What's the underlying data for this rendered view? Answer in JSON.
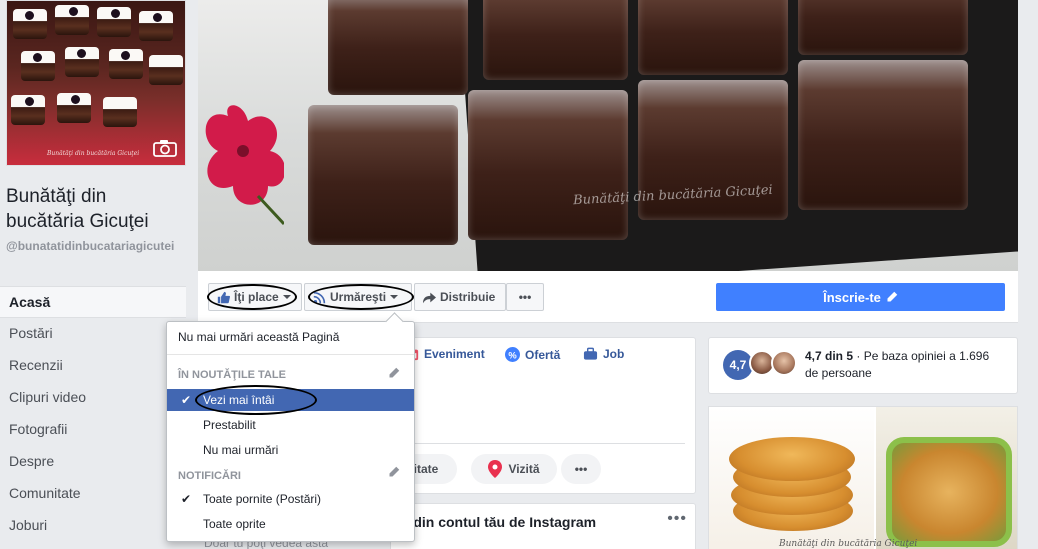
{
  "page": {
    "name": "Bunătăţi din bucătăria Gicuţei",
    "handle": "@bunatatidinbucatariagicutei",
    "profile_caption": "Bunătăţi din bucătăria Gicuţei",
    "cover_watermark": "Bunătăţi din bucătăria Gicuţei"
  },
  "nav": [
    {
      "label": "Acasă",
      "active": true
    },
    {
      "label": "Postări"
    },
    {
      "label": "Recenzii"
    },
    {
      "label": "Clipuri video"
    },
    {
      "label": "Fotografii"
    },
    {
      "label": "Despre"
    },
    {
      "label": "Comunitate"
    },
    {
      "label": "Joburi"
    }
  ],
  "actions": {
    "like": "Îţi place",
    "follow": "Urmăreşti",
    "share": "Distribuie",
    "more": "•••",
    "signup": "Înscrie-te"
  },
  "dropdown": {
    "unfollow_page": "Nu mai urmări această Pagină",
    "newsfeed_header": "ÎN NOUTĂŢILE TALE",
    "see_first": "Vezi mai întâi",
    "default": "Prestabilit",
    "unfollow": "Nu mai urmări",
    "notifications_header": "NOTIFICĂRI",
    "all_on": "Toate pornite (Postări)",
    "all_off": "Toate oprite"
  },
  "composer": {
    "tabs": [
      "Eveniment",
      "Ofertă",
      "Job"
    ],
    "activity": "ivitate",
    "visit": "Vizită",
    "more": "•••"
  },
  "instagram": {
    "title": "tă din contul tău de Instagram",
    "more": "•••",
    "only_you": "Doar tu poţi vedea asta"
  },
  "rating": {
    "badge": "4,7",
    "score": "4,7 din 5",
    "text": " · Pe baza opiniei a 1.696 de persoane"
  },
  "photo": {
    "watermark": "Bunătăţi din bucătăria Gicuţei"
  },
  "colors": {
    "facebook_blue": "#4267b2",
    "signup_blue": "#4080ff",
    "link_blue": "#365899",
    "background": "#e9ebee"
  }
}
